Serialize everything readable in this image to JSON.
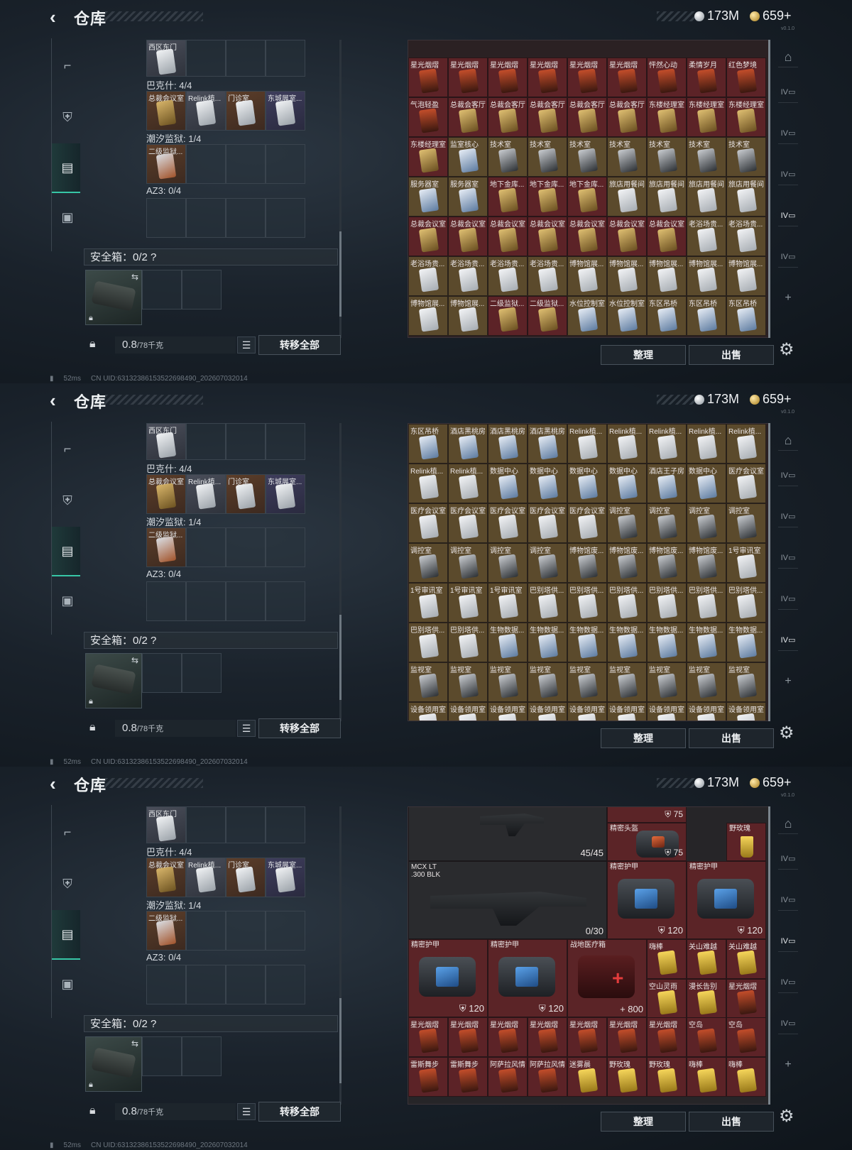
{
  "common": {
    "title": "仓库",
    "silver": "173M",
    "gold": "659+",
    "ver": "v0.1.0",
    "sections": {
      "bakes": "巴克什: 4/4",
      "chaoxi": "潮汐监狱: 1/4",
      "az3": "AZ3: 0/4",
      "safe": "安全箱：0/2",
      "help": "?"
    },
    "row0_label": "西区东门",
    "bakes_items": [
      "总裁会议室",
      "Relink植...",
      "门诊室",
      "东城展室..."
    ],
    "chaoxi_items": [
      "二级监狱..."
    ],
    "weight": "0.8",
    "weight_max": "/78千克",
    "transfer": "转移全部",
    "sort": "整理",
    "sell": "出售",
    "status_ping": "52ms",
    "status_uid": "CN UID:631323861535226984​90_202607032014"
  },
  "screen1": {
    "rows": [
      [
        "星光烟熠",
        "星光烟熠",
        "星光烟熠",
        "星光烟熠",
        "星光烟熠",
        "星光烟熠",
        "怦然心动",
        "柔情岁月",
        "红色梦境"
      ],
      [
        "气泡轻盈",
        "总裁会客厅",
        "总裁会客厅",
        "总裁会客厅",
        "总裁会客厅",
        "总裁会客厅",
        "东楼经理室",
        "东楼经理室",
        "东楼经理室"
      ],
      [
        "东楼经理室",
        "监室核心",
        "技术室",
        "技术室",
        "技术室",
        "技术室",
        "技术室",
        "技术室",
        "技术室"
      ],
      [
        "服务器室",
        "服务器室",
        "地下金库...",
        "地下金库...",
        "地下金库...",
        "旅店用餐间",
        "旅店用餐间",
        "旅店用餐间",
        "旅店用餐间"
      ],
      [
        "总裁会议室",
        "总裁会议室",
        "总裁会议室",
        "总裁会议室",
        "总裁会议室",
        "总裁会议室",
        "总裁会议室",
        "老浴场贵...",
        "老浴场贵..."
      ],
      [
        "老浴场贵...",
        "老浴场贵...",
        "老浴场贵...",
        "老浴场贵...",
        "博物馆展...",
        "博物馆展...",
        "博物馆展...",
        "博物馆展...",
        "博物馆展..."
      ],
      [
        "博物馆展...",
        "博物馆展...",
        "二级监狱...",
        "二级监狱...",
        "水位控制室",
        "水位控制室",
        "东区吊桥",
        "东区吊桥",
        "东区吊桥"
      ]
    ]
  },
  "screen2": {
    "rows": [
      [
        "东区吊桥",
        "酒店黑桃房",
        "酒店黑桃房",
        "酒店黑桃房",
        "Relink植...",
        "Relink植...",
        "Relink植...",
        "Relink植...",
        "Relink植..."
      ],
      [
        "Relink植...",
        "Relink植...",
        "数据中心",
        "数据中心",
        "数据中心",
        "数据中心",
        "酒店王子房",
        "数据中心",
        "医疗会议室"
      ],
      [
        "医疗会议室",
        "医疗会议室",
        "医疗会议室",
        "医疗会议室",
        "医疗会议室",
        "调控室",
        "调控室",
        "调控室",
        "调控室"
      ],
      [
        "调控室",
        "调控室",
        "调控室",
        "调控室",
        "博物馆废...",
        "博物馆废...",
        "博物馆废...",
        "博物馆废...",
        "1号审讯室"
      ],
      [
        "1号审讯室",
        "1号审讯室",
        "1号审讯室",
        "巴别塔供...",
        "巴别塔供...",
        "巴别塔供...",
        "巴别塔供...",
        "巴别塔供...",
        "巴别塔供..."
      ],
      [
        "巴别塔供...",
        "巴别塔供...",
        "生物数据...",
        "生物数据...",
        "生物数据...",
        "生物数据...",
        "生物数据...",
        "生物数据...",
        "生物数据..."
      ],
      [
        "监视室",
        "监视室",
        "监视室",
        "监视室",
        "监视室",
        "监视室",
        "监视室",
        "监视室",
        "监视室"
      ],
      [
        "设备领用室",
        "设备领用室",
        "设备领用室",
        "设备领用室",
        "设备领用室",
        "设备领用室",
        "设备领用室",
        "设备领用室",
        "设备领用室"
      ]
    ]
  },
  "screen3": {
    "top_ammo": "45/45",
    "helmet_label": "精密头盔",
    "helmet_val": "75",
    "helmet_top_val": "75",
    "drink_top": "野玫瑰",
    "gun_label": "MCX LT\n.300 BLK",
    "gun_ammo": "0/30",
    "vest_label": "精密护甲",
    "vest_val": "120",
    "med_label": "战地医疗箱",
    "med_val": "800",
    "row_drinks_a": [
      "嗨棒",
      "关山难越",
      "关山难越"
    ],
    "row_drinks_b": [
      "空山灵雨",
      "漫长告别",
      "星光烟熠"
    ],
    "row_drinks_c": [
      "星光烟熠",
      "星光烟熠",
      "星光烟熠",
      "星光烟熠",
      "星光烟熠",
      "星光烟熠",
      "星光烟熠",
      "空岛"
    ],
    "row_drinks_d": [
      "雷斯舞步",
      "雷斯舞步",
      "阿萨拉风情",
      "阿萨拉风情",
      "迷雾晨",
      "野玫瑰",
      "野玫瑰",
      "嗨棒",
      "嗨棒"
    ]
  },
  "icons": [
    "back-arrow-icon",
    "pistol-icon",
    "armor-icon",
    "backpack-icon",
    "briefcase-icon",
    "lock-icon",
    "list-icon",
    "gear-icon",
    "swap-icon",
    "plus-icon",
    "shield-icon",
    "medical-cross-icon"
  ]
}
